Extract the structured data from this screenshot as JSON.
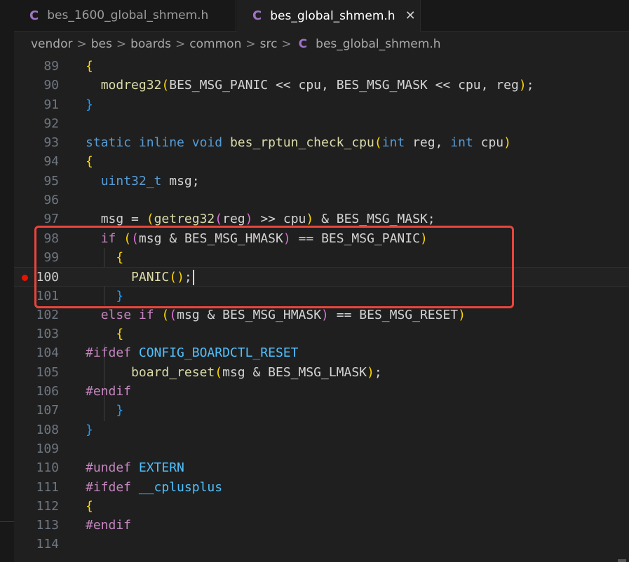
{
  "tabs": [
    {
      "icon": "c-file-icon",
      "icon_text": "C",
      "label": "bes_1600_global_shmem.h",
      "active": false
    },
    {
      "icon": "c-file-icon",
      "icon_text": "C",
      "label": "bes_global_shmem.h",
      "active": true,
      "close_icon": "close-icon",
      "close_glyph": "✕"
    }
  ],
  "breadcrumb": {
    "items": [
      "vendor",
      "bes",
      "boards",
      "common",
      "src"
    ],
    "separator": ">",
    "file_icon_text": "C",
    "file": "bes_global_shmem.h"
  },
  "editor": {
    "active_line": "100",
    "breakpoint_line": "100",
    "lines": [
      {
        "n": "89",
        "code": "{"
      },
      {
        "n": "90",
        "code": "  modreg32(BES_MSG_PANIC << cpu, BES_MSG_MASK << cpu, reg);"
      },
      {
        "n": "91",
        "code": "}"
      },
      {
        "n": "92",
        "code": ""
      },
      {
        "n": "93",
        "code": "static inline void bes_rptun_check_cpu(int reg, int cpu)"
      },
      {
        "n": "94",
        "code": "{"
      },
      {
        "n": "95",
        "code": "  uint32_t msg;"
      },
      {
        "n": "96",
        "code": ""
      },
      {
        "n": "97",
        "code": "  msg = (getreg32(reg) >> cpu) & BES_MSG_MASK;"
      },
      {
        "n": "98",
        "code": "  if ((msg & BES_MSG_HMASK) == BES_MSG_PANIC)"
      },
      {
        "n": "99",
        "code": "    {"
      },
      {
        "n": "100",
        "code": "      PANIC();"
      },
      {
        "n": "101",
        "code": "    }"
      },
      {
        "n": "102",
        "code": "  else if ((msg & BES_MSG_HMASK) == BES_MSG_RESET)"
      },
      {
        "n": "103",
        "code": "    {"
      },
      {
        "n": "104",
        "code": "#ifdef CONFIG_BOARDCTL_RESET"
      },
      {
        "n": "105",
        "code": "      board_reset(msg & BES_MSG_LMASK);"
      },
      {
        "n": "106",
        "code": "#endif"
      },
      {
        "n": "107",
        "code": "    }"
      },
      {
        "n": "108",
        "code": "}"
      },
      {
        "n": "109",
        "code": ""
      },
      {
        "n": "110",
        "code": "#undef EXTERN"
      },
      {
        "n": "111",
        "code": "#ifdef __cplusplus"
      },
      {
        "n": "112",
        "code": "{"
      },
      {
        "n": "113",
        "code": "#endif"
      },
      {
        "n": "114",
        "code": ""
      }
    ]
  },
  "colors": {
    "accent_annotation": "#e8453c",
    "breakpoint": "#e51400",
    "c_icon": "#a074c4"
  }
}
